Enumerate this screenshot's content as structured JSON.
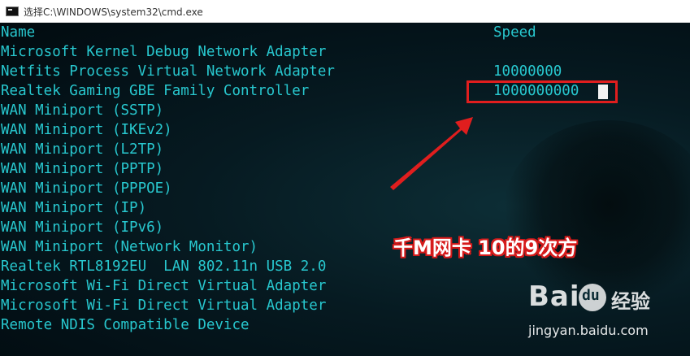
{
  "window": {
    "title": "选择C:\\WINDOWS\\system32\\cmd.exe",
    "icon": "console-icon"
  },
  "console": {
    "headers": {
      "name": "Name",
      "speed": "Speed"
    },
    "rows": [
      {
        "name": "Microsoft Kernel Debug Network Adapter",
        "speed": ""
      },
      {
        "name": "Netfits Process Virtual Network Adapter",
        "speed": "10000000"
      },
      {
        "name": "Realtek Gaming GBE Family Controller",
        "speed": "1000000000"
      },
      {
        "name": "WAN Miniport (SSTP)",
        "speed": ""
      },
      {
        "name": "WAN Miniport (IKEv2)",
        "speed": ""
      },
      {
        "name": "WAN Miniport (L2TP)",
        "speed": ""
      },
      {
        "name": "WAN Miniport (PPTP)",
        "speed": ""
      },
      {
        "name": "WAN Miniport (PPPOE)",
        "speed": ""
      },
      {
        "name": "WAN Miniport (IP)",
        "speed": ""
      },
      {
        "name": "WAN Miniport (IPv6)",
        "speed": ""
      },
      {
        "name": "WAN Miniport (Network Monitor)",
        "speed": ""
      },
      {
        "name": "Realtek RTL8192EU  LAN 802.11n USB 2.0",
        "speed": ""
      },
      {
        "name": "Microsoft Wi-Fi Direct Virtual Adapter",
        "speed": ""
      },
      {
        "name": "Microsoft Wi-Fi Direct Virtual Adapter",
        "speed": ""
      },
      {
        "name": "Remote NDIS Compatible Device",
        "speed": ""
      }
    ]
  },
  "annotation": {
    "text": "千M网卡 10的9次方",
    "color": "#d61a1a"
  },
  "watermark": {
    "logo": "Bai",
    "paw": "du",
    "cn": "经验",
    "url": "jingyan.baidu.com"
  },
  "colors": {
    "text": "#28c8cf",
    "background": "#061a21",
    "highlight": "#e01e1e"
  }
}
